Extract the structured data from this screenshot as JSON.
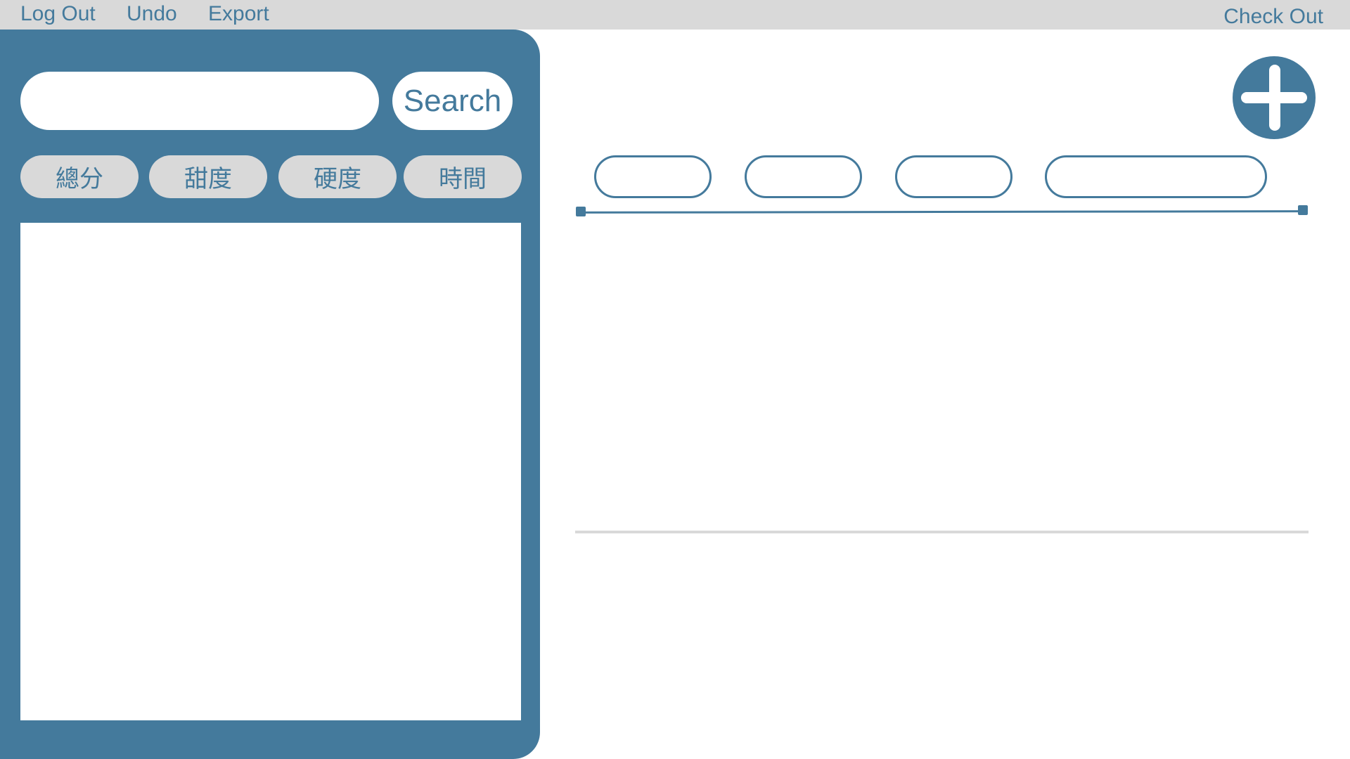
{
  "menu": {
    "logout": "Log Out",
    "undo": "Undo",
    "export": "Export",
    "checkout": "Check Out"
  },
  "search": {
    "placeholder": "",
    "value": "",
    "button_label": "Search"
  },
  "sort_options": [
    {
      "label": "總分"
    },
    {
      "label": "甜度"
    },
    {
      "label": "硬度"
    },
    {
      "label": "時間"
    }
  ],
  "tabs": [
    {
      "label": ""
    },
    {
      "label": ""
    },
    {
      "label": ""
    },
    {
      "label": ""
    }
  ],
  "icons": {
    "add": "plus-icon"
  },
  "colors": {
    "accent": "#447a9c",
    "menu_bar": "#d9d9d9",
    "pill_bg": "#d9d9d9",
    "background": "#ffffff"
  }
}
